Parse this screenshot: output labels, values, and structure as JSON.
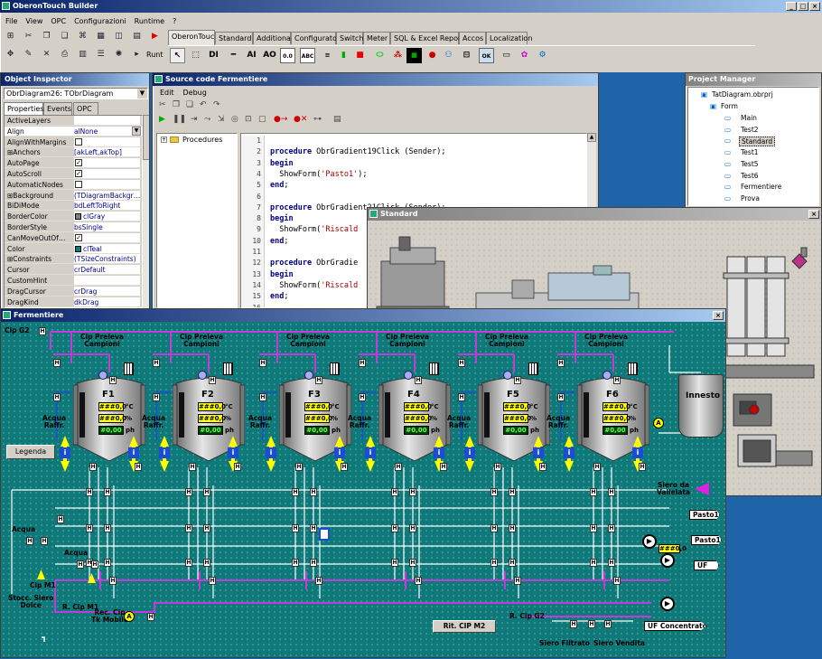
{
  "app": {
    "title": "OberonTouch Builder"
  },
  "menu": [
    "File",
    "View",
    "OPC",
    "Configurazioni",
    "Runtime",
    "?"
  ],
  "palette_tabs": [
    "OberonTouch",
    "Standard",
    "Additional",
    "Configurator",
    "Switch",
    "Meter",
    "SQL & Excel Report",
    "Accos",
    "Localization"
  ],
  "palette_text": {
    "di": "DI",
    "ai": "AI",
    "ao": "AO",
    "runtime": "Runt"
  },
  "inspector": {
    "title": "Object Inspector",
    "selected": "ObrDiagram26: TObrDiagram",
    "tabs": [
      "Properties",
      "Events",
      "OPC"
    ],
    "props": [
      {
        "name": "ActiveLayers",
        "value": ""
      },
      {
        "name": "Align",
        "value": "alNone"
      },
      {
        "name": "AlignWithMargins",
        "value": ""
      },
      {
        "name": "⊞Anchors",
        "value": "[akLeft,akTop]"
      },
      {
        "name": "AutoPage",
        "value": ""
      },
      {
        "name": "AutoScroll",
        "value": ""
      },
      {
        "name": "AutomaticNodes",
        "value": ""
      },
      {
        "name": "⊞Background",
        "value": "(TDiagramBackgr…"
      },
      {
        "name": "BiDiMode",
        "value": "bdLeftToRight"
      },
      {
        "name": "BorderColor",
        "value": "clGray"
      },
      {
        "name": "BorderStyle",
        "value": "bsSingle"
      },
      {
        "name": "CanMoveOutOf…",
        "value": ""
      },
      {
        "name": "Color",
        "value": "clTeal"
      },
      {
        "name": "⊞Constraints",
        "value": "(TSizeConstraints)"
      },
      {
        "name": "Cursor",
        "value": "crDefault"
      },
      {
        "name": "CustomHint",
        "value": ""
      },
      {
        "name": "DragCursor",
        "value": "crDrag"
      },
      {
        "name": "DragKind",
        "value": "dkDrag"
      }
    ]
  },
  "source": {
    "title": "Source code Fermentiere",
    "menu": [
      "Edit",
      "Debug"
    ],
    "tree_root": "Procedures",
    "lines": [
      {
        "n": "1",
        "t": ""
      },
      {
        "n": "2",
        "t": "procedure ObrGradient19Click (Sender);"
      },
      {
        "n": "3",
        "t": "begin"
      },
      {
        "n": "4",
        "t": "  ShowForm('Pasto1');"
      },
      {
        "n": "5",
        "t": "end;"
      },
      {
        "n": "6",
        "t": ""
      },
      {
        "n": "7",
        "t": "procedure ObrGradient21Click (Sender);"
      },
      {
        "n": "8",
        "t": "begin"
      },
      {
        "n": "9",
        "t": "  ShowForm('Riscald"
      },
      {
        "n": "10",
        "t": "end;"
      },
      {
        "n": "11",
        "t": ""
      },
      {
        "n": "12",
        "t": "procedure ObrGradie"
      },
      {
        "n": "13",
        "t": "begin"
      },
      {
        "n": "14",
        "t": "  ShowForm('Riscald"
      },
      {
        "n": "15",
        "t": "end;"
      },
      {
        "n": "16",
        "t": ""
      }
    ]
  },
  "project": {
    "title": "Project Manager",
    "root": "TatDiagram.obrprj",
    "folder": "Form",
    "items": [
      "Main",
      "Test2",
      "Standard",
      "Test1",
      "Test5",
      "Test6",
      "Fermentiere",
      "Prova"
    ],
    "selected": "Standard"
  },
  "standard_window": {
    "title": "Standard"
  },
  "fermentiere": {
    "title": "Fermentiere",
    "tanks": [
      "F1",
      "F2",
      "F3",
      "F4",
      "F5",
      "F6"
    ],
    "readout_value": "###0,0",
    "readout_ph": "#0,00",
    "units": [
      "°C",
      "%",
      "ph"
    ],
    "cip_label": "Cip Preleva\nCampioni",
    "acqua_raffr": "Acqua\nRaffr.",
    "innesto": "Innesto",
    "legend_button": "Legenda",
    "cip_g2_top": "Cip G2",
    "siero_vallelata": "Siero da\nVallelata",
    "pasto1_a": "Pasto1",
    "pasto1_b": "Pasto1",
    "uf": "UF",
    "uf_readout": "###0,0",
    "acqua_left": "Acqua",
    "acqua_mid": "Acqua",
    "cip_m1": "Cip M1",
    "r_cip_m1": "R. Cip M1",
    "stocc": "Stocc. Siero\nDolce",
    "rec_cip": "Rec. Cip\nTk Mobile",
    "rit_cip_m2": "Rit. CIP M2",
    "r_cip_g2": "R. Cip G2",
    "uf_concentrato": "UF Concentrato",
    "siero_filtrato": "Siero Filtrato",
    "siero_vendita": "Siero Vendita",
    "badge_a": "A",
    "valve_h": "H",
    "valve_i": "i"
  },
  "colors": {
    "teal": "#0f7878",
    "pipe_magenta": "#c23ad9",
    "pipe_white": "#ffffff",
    "indicator_yellow": "#ffff00",
    "valve_blue": "#1a4cd8"
  }
}
